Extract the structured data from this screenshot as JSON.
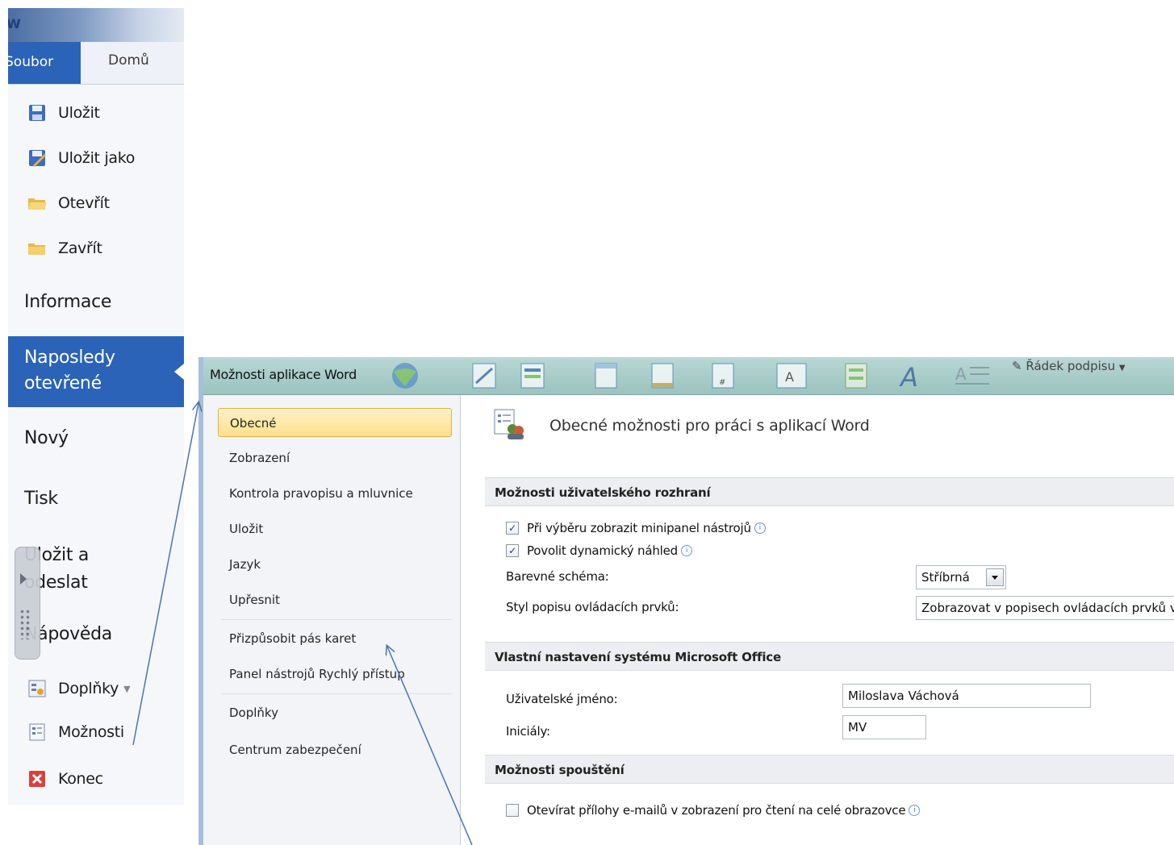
{
  "backstage": {
    "tabs": [
      {
        "label": "Soubor"
      },
      {
        "label": "Domů"
      }
    ],
    "items": [
      {
        "label": "Uložit",
        "icon": "save-icon"
      },
      {
        "label": "Uložit jako",
        "icon": "save-as-icon"
      },
      {
        "label": "Otevřít",
        "icon": "open-folder-icon"
      },
      {
        "label": "Zavřít",
        "icon": "close-folder-icon"
      }
    ],
    "informace": "Informace",
    "recent_line1": "Naposledy",
    "recent_line2": "otevřené",
    "novy": "Nový",
    "tisk": "Tisk",
    "send_line1": "Uložit a",
    "send_line2": "odeslat",
    "napoveda": "Nápověda",
    "doplnky": "Doplňky",
    "moznosti": "Možnosti",
    "konec": "Konec"
  },
  "dialog": {
    "title": "Možnosti aplikace Word",
    "ribbon_signature": "Řádek podpisu",
    "nav": [
      {
        "label": "Obecné",
        "selected": true
      },
      {
        "label": "Zobrazení"
      },
      {
        "label": "Kontrola pravopisu a mluvnice"
      },
      {
        "label": "Uložit"
      },
      {
        "label": "Jazyk"
      },
      {
        "label": "Upřesnit"
      },
      {
        "label": "Přizpůsobit pás karet"
      },
      {
        "label": "Panel nástrojů Rychlý přístup"
      },
      {
        "label": "Doplňky"
      },
      {
        "label": "Centrum zabezpečení"
      }
    ],
    "heading": "Obecné možnosti pro práci s aplikací Word",
    "sections": {
      "ui": "Možnosti uživatelského rozhraní",
      "office": "Vlastní nastavení systému Microsoft Office",
      "startup": "Možnosti spouštění"
    },
    "ui_options": {
      "minitoolbar": {
        "label": "Při výběru zobrazit minipanel nástrojů",
        "checked": true
      },
      "live_preview": {
        "label": "Povolit dynamický náhled",
        "checked": true
      },
      "color_scheme_label": "Barevné schéma:",
      "color_scheme_value": "Stříbrná",
      "tooltip_style_label": "Styl popisu ovládacích prvků:",
      "tooltip_style_value": "Zobrazovat v popisech ovládacích prvků vysvětlení funkcí"
    },
    "office_settings": {
      "username_label": "Uživatelské jméno:",
      "username_value": "Miloslava Váchová",
      "initials_label": "Iniciály:",
      "initials_value": "MV"
    },
    "startup_options": {
      "open_attachments": {
        "label": "Otevírat přílohy e-mailů v zobrazení pro čtení na celé obrazovce",
        "checked": false
      }
    }
  },
  "colors": {
    "accent_blue": "#2a63b8",
    "nav_selected": "#ffe08a",
    "dialog_title": "#a9cdc8",
    "arrow": "#4a74b4"
  }
}
